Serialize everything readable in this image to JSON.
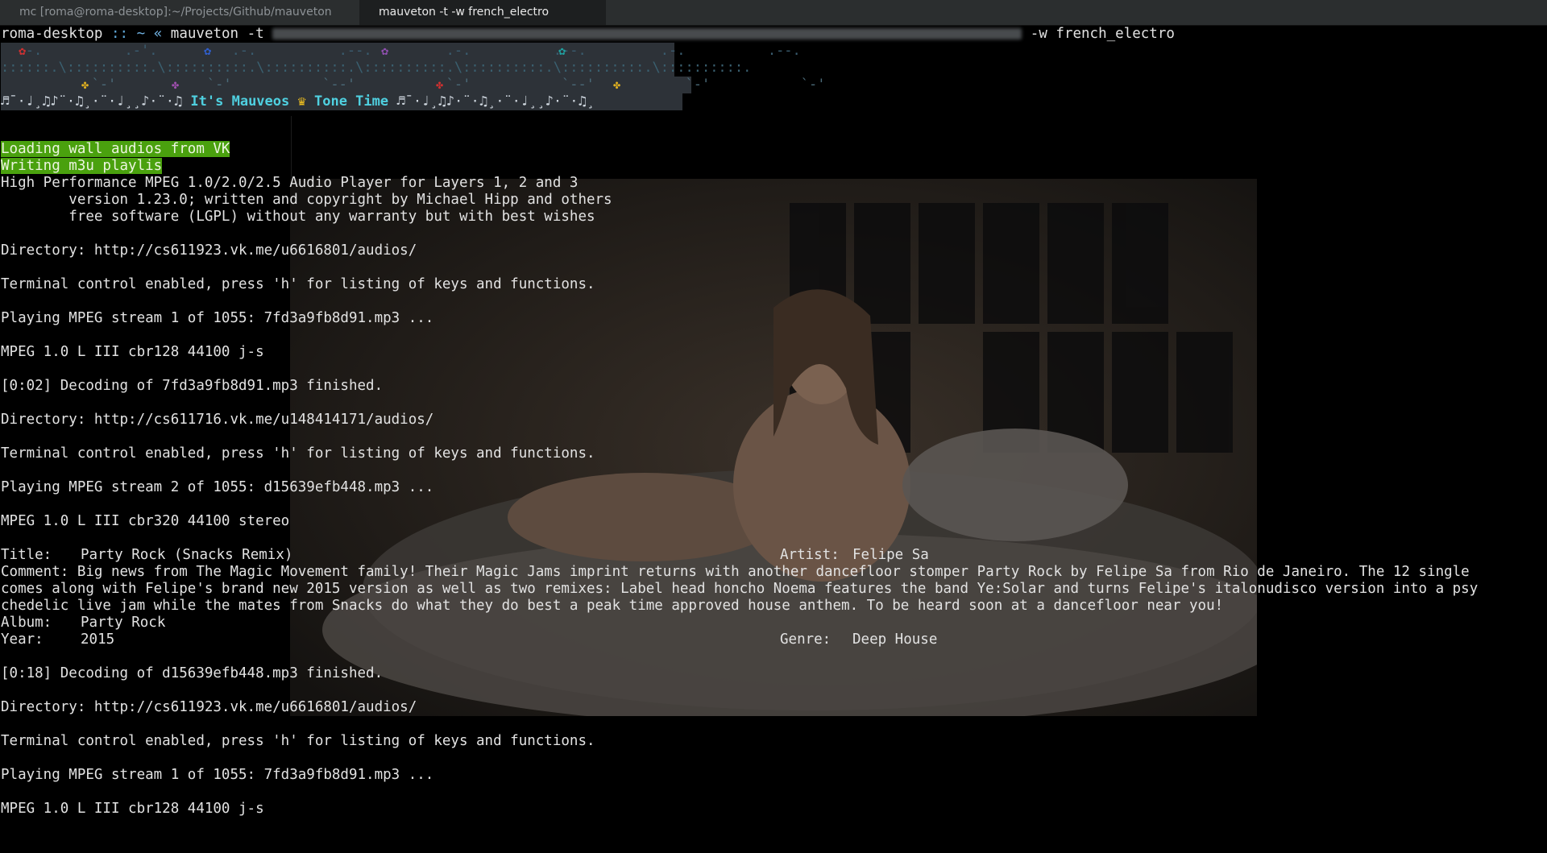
{
  "tabs": [
    {
      "label": "mc [roma@roma-desktop]:~/Projects/Github/mauveton"
    },
    {
      "label": "mauveton -t  -w french_electro"
    }
  ],
  "prompt": {
    "host": "roma-desktop",
    "separator": "::",
    "path": "~",
    "arrow": "«",
    "command": "mauveton -t",
    "args_after": "-w french_electro"
  },
  "banner": {
    "left_notes": "♬¯·♩¸♫♪¨·♫¸·¨·♩¸¸♪·¨·♫",
    "title_a": "It's Mauveos",
    "crown": "♛",
    "title_b": "Tone Time",
    "right_notes": "♬¯·♩¸♫♪·¨·♫¸·¨·♩¸¸♪·¨·♫¸"
  },
  "status_messages": [
    "Loading wall audios from VK",
    "Writing m3u playlis"
  ],
  "output": [
    "High Performance MPEG 1.0/2.0/2.5 Audio Player for Layers 1, 2 and 3",
    "        version 1.23.0; written and copyright by Michael Hipp and others",
    "        free software (LGPL) without any warranty but with best wishes",
    "",
    "Directory: http://cs611923.vk.me/u6616801/audios/",
    "",
    "Terminal control enabled, press 'h' for listing of keys and functions.",
    "",
    "Playing MPEG stream 1 of 1055: 7fd3a9fb8d91.mp3 ...",
    "",
    "MPEG 1.0 L III cbr128 44100 j-s",
    "",
    "[0:02] Decoding of 7fd3a9fb8d91.mp3 finished.",
    "",
    "Directory: http://cs611716.vk.me/u148414171/audios/",
    "",
    "Terminal control enabled, press 'h' for listing of keys and functions.",
    "",
    "Playing MPEG stream 2 of 1055: d15639efb448.mp3 ...",
    "",
    "MPEG 1.0 L III cbr320 44100 stereo",
    ""
  ],
  "track": {
    "title_key": "Title:",
    "title": "Party Rock (Snacks Remix)",
    "artist_key": "Artist:",
    "artist": "Felipe Sa",
    "comment_lines": [
      "Comment: Big news from The Magic Movement family! Their Magic Jams imprint returns with another dancefloor stomper Party Rock by Felipe Sa from Rio de Janeiro. The 12 single",
      "comes along with Felipe's brand new 2015 version as well as two remixes: Label head honcho Noema features the band Ye:Solar and turns Felipe's italonudisco version into a psy",
      "chedelic live jam while the mates from Snacks do what they do best a peak time approved house anthem. To be heard soon at a dancefloor near you!"
    ],
    "album_key": "Album:",
    "album": "Party Rock",
    "year_key": "Year:",
    "year": "2015",
    "genre_key": "Genre:",
    "genre": "Deep House"
  },
  "output_after": [
    "",
    "[0:18] Decoding of d15639efb448.mp3 finished.",
    "",
    "Directory: http://cs611923.vk.me/u6616801/audios/",
    "",
    "Terminal control enabled, press 'h' for listing of keys and functions.",
    "",
    "Playing MPEG stream 1 of 1055: 7fd3a9fb8d91.mp3 ...",
    "",
    "MPEG 1.0 L III cbr128 44100 j-s"
  ],
  "colors": {
    "background": "#000000",
    "text": "#e2e2e2",
    "highlight": "#4aa10e",
    "banner_cyan": "#4fd0e0",
    "tabbar": "#2b2e2f"
  }
}
